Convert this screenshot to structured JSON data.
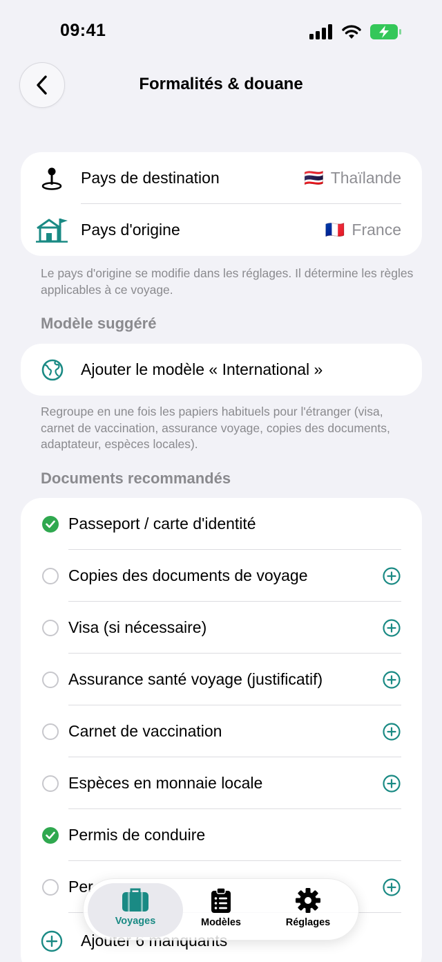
{
  "status": {
    "time": "09:41"
  },
  "header": {
    "title": "Formalités & douane"
  },
  "countries": [
    {
      "label": "Pays de destination",
      "flag": "🇹🇭",
      "value": "Thaïlande"
    },
    {
      "label": "Pays d'origine",
      "flag": "🇫🇷",
      "value": "France"
    }
  ],
  "origin_note": "Le pays d'origine se modifie dans les réglages. Il détermine les règles applicables à ce voyage.",
  "suggested": {
    "section_title": "Modèle suggéré",
    "action_label": "Ajouter le modèle « International »",
    "note": "Regroupe en une fois les papiers habituels pour l'étranger (visa, carnet de vaccination, assurance voyage, copies des documents, adaptateur, espèces locales)."
  },
  "documents": {
    "section_title": "Documents recommandés",
    "items": [
      {
        "label": "Passeport / carte d'identité",
        "done": true
      },
      {
        "label": "Copies des documents de voyage",
        "done": false
      },
      {
        "label": "Visa (si nécessaire)",
        "done": false
      },
      {
        "label": "Assurance santé voyage (justificatif)",
        "done": false
      },
      {
        "label": "Carnet de vaccination",
        "done": false
      },
      {
        "label": "Espèces en monnaie locale",
        "done": false
      },
      {
        "label": "Permis de conduire",
        "done": true
      },
      {
        "label": "Per",
        "done": false
      }
    ],
    "add_missing_label": "Ajouter 6 manquants"
  },
  "tabs": [
    {
      "label": "Voyages",
      "icon": "suitcase-icon",
      "active": true
    },
    {
      "label": "Modèles",
      "icon": "clipboard-list-icon",
      "active": false
    },
    {
      "label": "Réglages",
      "icon": "gear-icon",
      "active": false
    }
  ],
  "colors": {
    "accent": "#1a8a84",
    "done": "#2fa84f",
    "battery": "#34c759",
    "background": "#f2f2f7"
  }
}
